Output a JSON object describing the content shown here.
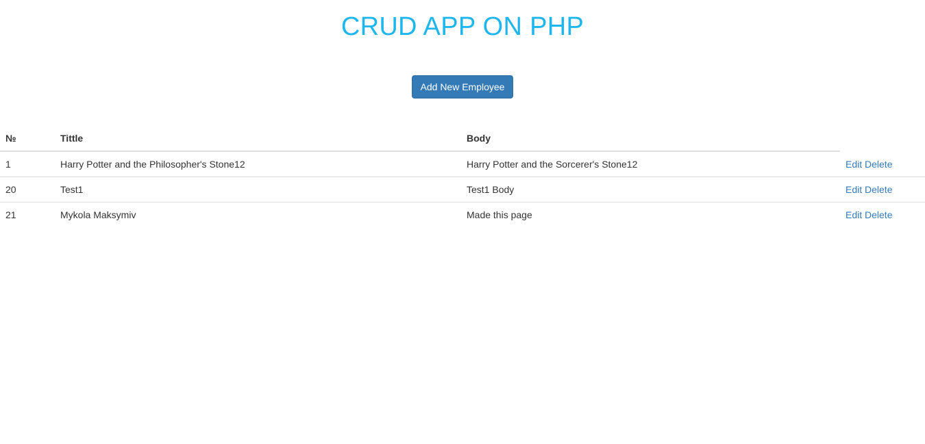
{
  "header": {
    "title": "CRUD APP ON PHP"
  },
  "toolbar": {
    "add_label": "Add New Employee"
  },
  "table": {
    "columns": [
      "№",
      "Tittle",
      "Body",
      ""
    ],
    "rows": [
      {
        "id": "1",
        "title": "Harry Potter and the Philosopher's Stone12",
        "body": "Harry Potter and the Sorcerer's Stone12",
        "edit": "Edit",
        "delete": "Delete"
      },
      {
        "id": "20",
        "title": "Test1",
        "body": "Test1 Body",
        "edit": "Edit",
        "delete": "Delete"
      },
      {
        "id": "21",
        "title": "Mykola Maksymiv",
        "body": "Made this page",
        "edit": "Edit",
        "delete": "Delete"
      }
    ]
  },
  "colors": {
    "title": "#1fb5ed",
    "primary_button": "#337ab7",
    "link": "#337ab7"
  }
}
